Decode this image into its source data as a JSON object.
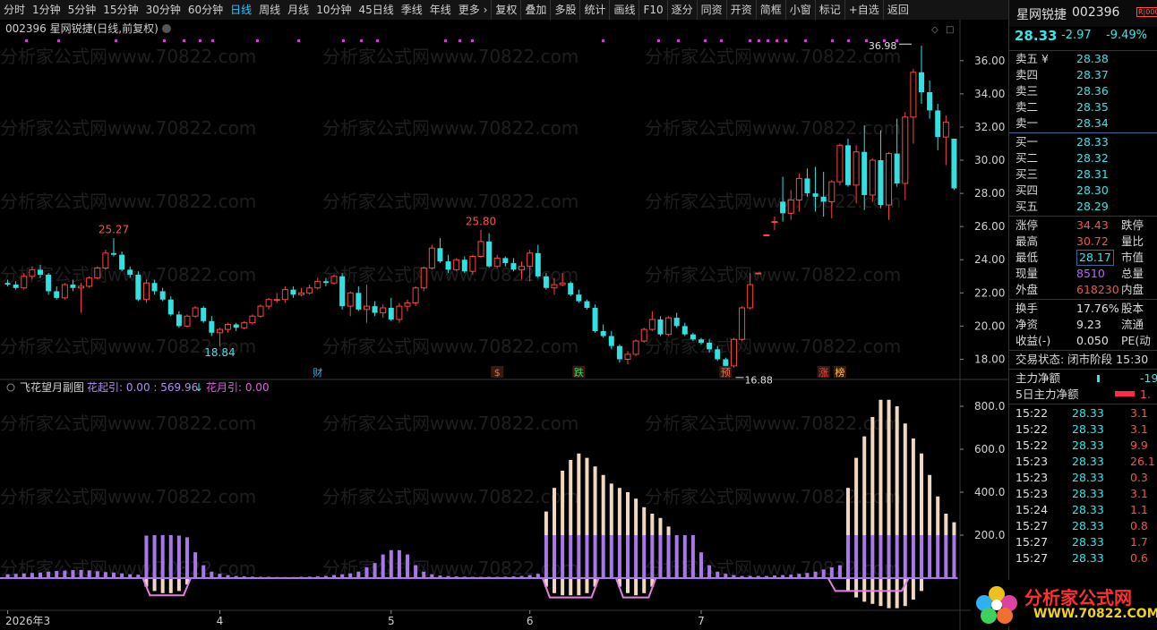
{
  "toolbar": {
    "periods": [
      "分时",
      "1分钟",
      "5分钟",
      "15分钟",
      "30分钟",
      "60分钟",
      "日线",
      "周线",
      "月线",
      "10分钟",
      "45日线",
      "季线",
      "年线",
      "更多 ›"
    ],
    "active_period": "日线",
    "tools": [
      "复权",
      "叠加",
      "多股",
      "统计",
      "画线",
      "F10",
      "逐分",
      "同资",
      "开资",
      "简框",
      "小窗",
      "标记",
      "+自选",
      "返回"
    ]
  },
  "stock": {
    "name": "星网锐捷",
    "code": "002396",
    "badge": "R|000",
    "price": "28.33",
    "change": "-2.97",
    "change_pct": "-9.49%"
  },
  "chart_header": "002396 星网锐捷(日线,前复权)",
  "indicator_header": {
    "name": "飞花望月副图",
    "term1_label": "花起引: 0.00 : 569.96",
    "arrow": "↓",
    "term2_label": "花月引: 0.00"
  },
  "watermark": "分析家公式网www.70822.com",
  "annotations": {
    "high_left": "25.27",
    "low_left": "18.84",
    "high_mid": "25.80",
    "low_right": "16.88",
    "high_right": "36.98"
  },
  "event_markers": [
    "财",
    "$",
    "跌",
    "预",
    "涨",
    "榜"
  ],
  "price_axis": {
    "min": 17,
    "max": 37.5,
    "ticks": [
      36.0,
      34.0,
      32.0,
      30.0,
      28.0,
      26.0,
      24.0,
      22.0,
      20.0,
      18.0
    ]
  },
  "ind_axis": {
    "min": -150,
    "max": 900,
    "ticks": [
      800.0,
      600.0,
      400.0,
      200.0
    ]
  },
  "x_axis_labels": [
    {
      "text": "2026年3",
      "index": 0
    },
    {
      "text": "4",
      "index": 26
    },
    {
      "text": "5",
      "index": 47
    },
    {
      "text": "6",
      "index": 64
    },
    {
      "text": "7",
      "index": 85
    }
  ],
  "order_book": {
    "sell": [
      {
        "label": "卖五 ¥",
        "price": "28.38"
      },
      {
        "label": "卖四",
        "price": "28.37"
      },
      {
        "label": "卖三",
        "price": "28.36"
      },
      {
        "label": "卖二",
        "price": "28.35"
      },
      {
        "label": "卖一",
        "price": "28.34"
      }
    ],
    "buy": [
      {
        "label": "买一",
        "price": "28.33"
      },
      {
        "label": "买二",
        "price": "28.32"
      },
      {
        "label": "买三",
        "price": "28.31"
      },
      {
        "label": "买四",
        "price": "28.30"
      },
      {
        "label": "买五",
        "price": "28.29"
      }
    ]
  },
  "stats": [
    {
      "label": "涨停",
      "value": "34.43",
      "color": "red",
      "label2": "跌停"
    },
    {
      "label": "最高",
      "value": "30.72",
      "color": "red",
      "label2": "量比"
    },
    {
      "label": "最低",
      "value": "28.17",
      "color": "cyan",
      "label2": "市值"
    },
    {
      "label": "现量",
      "value": "8510",
      "color": "purple",
      "label2": "总量"
    },
    {
      "label": "外盘",
      "value": "618230",
      "color": "red",
      "label2": "内盘"
    }
  ],
  "stats2": [
    {
      "label": "换手",
      "value": "17.76%",
      "label2": "股本"
    },
    {
      "label": "净资",
      "value": "9.23",
      "label2": "流通"
    },
    {
      "label": "收益(-)",
      "value": "0.050",
      "label2": "PE(动"
    }
  ],
  "trade_status": "交易状态: 闭市阶段 15:30",
  "flows": [
    {
      "label": "主力净额",
      "value": "-19.",
      "bar": "cyan"
    },
    {
      "label": "5日主力净额",
      "value": "1.",
      "bar": "red"
    }
  ],
  "ticks": [
    {
      "time": "15:22",
      "price": "28.33",
      "vol": "3.1"
    },
    {
      "time": "15:22",
      "price": "28.33",
      "vol": "3.1"
    },
    {
      "time": "15:22",
      "price": "28.33",
      "vol": "9.9"
    },
    {
      "time": "15:23",
      "price": "28.33",
      "vol": "26.1"
    },
    {
      "time": "15:23",
      "price": "28.33",
      "vol": "0.3"
    },
    {
      "time": "15:23",
      "price": "28.33",
      "vol": "3.1"
    },
    {
      "time": "15:24",
      "price": "28.33",
      "vol": "1.1"
    },
    {
      "time": "15:27",
      "price": "28.33",
      "vol": "0.8"
    },
    {
      "time": "15:27",
      "price": "28.33",
      "vol": "1.7"
    },
    {
      "time": "15:27",
      "price": "28.33",
      "vol": "0.6"
    }
  ],
  "logo": {
    "line1": "分析家公式网",
    "line2": "WWW.70822.COM"
  },
  "colors": {
    "up": "#ff4444",
    "down": "#33e0e0",
    "ind_purple": "#a779e8",
    "ind_tan": "#f0d8c0",
    "ind_pink": "#e080e0"
  },
  "chart_data": {
    "type": "candlestick",
    "title": "002396 星网锐捷(日线,前复权)",
    "candles": [
      [
        22.6,
        22.8,
        22.4,
        22.5
      ],
      [
        22.5,
        22.7,
        22.2,
        22.3
      ],
      [
        22.3,
        23.2,
        22.2,
        23.0
      ],
      [
        23.0,
        23.6,
        22.8,
        23.4
      ],
      [
        23.4,
        23.7,
        22.9,
        23.1
      ],
      [
        23.1,
        23.2,
        21.9,
        22.1
      ],
      [
        22.1,
        22.4,
        21.6,
        21.7
      ],
      [
        21.7,
        22.6,
        21.6,
        22.5
      ],
      [
        22.5,
        22.8,
        22.1,
        22.3
      ],
      [
        22.3,
        22.6,
        20.8,
        22.4
      ],
      [
        22.4,
        23.0,
        22.3,
        22.9
      ],
      [
        22.9,
        23.6,
        22.8,
        23.5
      ],
      [
        23.5,
        24.6,
        23.4,
        24.4
      ],
      [
        24.4,
        25.3,
        24.2,
        24.3
      ],
      [
        24.3,
        24.5,
        23.3,
        23.4
      ],
      [
        23.4,
        23.6,
        22.9,
        23.1
      ],
      [
        23.1,
        23.3,
        21.5,
        21.6
      ],
      [
        21.6,
        22.8,
        21.4,
        22.6
      ],
      [
        22.6,
        22.8,
        21.9,
        22.1
      ],
      [
        22.1,
        22.3,
        21.5,
        21.6
      ],
      [
        21.6,
        21.8,
        20.6,
        20.7
      ],
      [
        20.7,
        20.9,
        19.9,
        20.0
      ],
      [
        20.0,
        20.7,
        19.9,
        20.6
      ],
      [
        20.6,
        21.2,
        20.5,
        21.1
      ],
      [
        21.1,
        21.2,
        20.2,
        20.3
      ],
      [
        20.3,
        20.6,
        19.4,
        19.6
      ],
      [
        19.6,
        19.9,
        18.8,
        19.8
      ],
      [
        19.8,
        20.2,
        19.6,
        20.1
      ],
      [
        20.1,
        20.2,
        19.7,
        19.9
      ],
      [
        19.9,
        20.3,
        19.8,
        20.2
      ],
      [
        20.2,
        20.7,
        20.1,
        20.6
      ],
      [
        20.6,
        21.3,
        20.5,
        21.2
      ],
      [
        21.2,
        21.7,
        21.0,
        21.6
      ],
      [
        21.6,
        22.0,
        21.4,
        21.6
      ],
      [
        21.6,
        22.4,
        21.4,
        22.2
      ],
      [
        22.2,
        22.4,
        21.7,
        21.9
      ],
      [
        21.9,
        22.3,
        21.8,
        22.0
      ],
      [
        22.0,
        22.5,
        21.9,
        22.3
      ],
      [
        22.3,
        22.9,
        22.2,
        22.7
      ],
      [
        22.7,
        22.9,
        22.4,
        22.6
      ],
      [
        22.6,
        23.1,
        22.5,
        23.0
      ],
      [
        23.0,
        23.2,
        21.0,
        21.2
      ],
      [
        21.2,
        22.1,
        20.6,
        22.0
      ],
      [
        22.0,
        22.4,
        20.9,
        21.0
      ],
      [
        21.0,
        22.5,
        20.2,
        21.2
      ],
      [
        21.2,
        21.5,
        20.6,
        20.8
      ],
      [
        20.8,
        21.3,
        20.5,
        21.1
      ],
      [
        21.1,
        21.7,
        20.3,
        20.4
      ],
      [
        20.4,
        21.4,
        20.2,
        21.2
      ],
      [
        21.2,
        21.6,
        20.9,
        21.4
      ],
      [
        21.4,
        22.4,
        21.2,
        22.3
      ],
      [
        22.3,
        23.6,
        22.1,
        23.5
      ],
      [
        23.5,
        24.9,
        23.4,
        24.7
      ],
      [
        24.7,
        25.3,
        23.8,
        23.9
      ],
      [
        23.9,
        24.3,
        23.2,
        23.4
      ],
      [
        23.4,
        24.1,
        23.3,
        24.0
      ],
      [
        24.0,
        24.2,
        23.2,
        23.3
      ],
      [
        23.3,
        24.3,
        23.1,
        24.2
      ],
      [
        24.2,
        25.8,
        24.1,
        25.1
      ],
      [
        25.1,
        25.6,
        23.5,
        23.6
      ],
      [
        23.6,
        24.3,
        23.5,
        24.1
      ],
      [
        24.1,
        24.2,
        23.6,
        23.8
      ],
      [
        23.8,
        24.1,
        23.3,
        23.4
      ],
      [
        23.4,
        23.9,
        22.8,
        23.6
      ],
      [
        23.6,
        24.6,
        22.7,
        24.4
      ],
      [
        24.4,
        24.9,
        22.9,
        23.0
      ],
      [
        23.0,
        23.2,
        22.2,
        22.3
      ],
      [
        22.3,
        22.9,
        21.9,
        22.5
      ],
      [
        22.5,
        23.2,
        22.4,
        22.6
      ],
      [
        22.6,
        22.7,
        21.8,
        21.9
      ],
      [
        21.9,
        22.2,
        21.4,
        21.5
      ],
      [
        21.5,
        21.6,
        21.0,
        21.1
      ],
      [
        21.1,
        21.3,
        19.6,
        19.7
      ],
      [
        19.7,
        20.1,
        19.3,
        19.4
      ],
      [
        19.4,
        19.7,
        18.6,
        18.8
      ],
      [
        18.8,
        18.9,
        17.8,
        18.0
      ],
      [
        18.0,
        18.5,
        17.7,
        18.3
      ],
      [
        18.3,
        19.2,
        18.2,
        19.1
      ],
      [
        19.1,
        19.9,
        19.0,
        19.8
      ],
      [
        19.8,
        20.9,
        19.7,
        20.4
      ],
      [
        20.4,
        20.6,
        19.4,
        19.5
      ],
      [
        19.5,
        20.6,
        19.4,
        20.5
      ],
      [
        20.5,
        20.8,
        19.9,
        20.0
      ],
      [
        20.0,
        20.2,
        19.4,
        19.5
      ],
      [
        19.5,
        19.6,
        19.1,
        19.2
      ],
      [
        19.2,
        19.3,
        18.9,
        19.0
      ],
      [
        19.0,
        19.2,
        18.4,
        18.6
      ],
      [
        18.6,
        18.8,
        17.9,
        18.0
      ],
      [
        18.0,
        18.1,
        16.9,
        17.6
      ],
      [
        17.6,
        19.3,
        17.5,
        19.2
      ],
      [
        19.2,
        21.2,
        19.1,
        21.1
      ],
      [
        21.1,
        23.2,
        21.0,
        22.5
      ],
      [
        23.2,
        23.2,
        23.2,
        23.2
      ],
      [
        25.5,
        25.5,
        25.5,
        25.5
      ],
      [
        26.3,
        26.6,
        25.8,
        26.3
      ],
      [
        27.5,
        29.0,
        26.3,
        26.8
      ],
      [
        26.8,
        28.2,
        26.4,
        27.6
      ],
      [
        27.6,
        29.2,
        26.9,
        28.9
      ],
      [
        28.9,
        29.5,
        27.8,
        28.0
      ],
      [
        28.0,
        29.6,
        26.9,
        27.8
      ],
      [
        27.8,
        29.3,
        26.6,
        27.5
      ],
      [
        27.5,
        28.8,
        26.5,
        28.7
      ],
      [
        28.7,
        31.0,
        28.5,
        30.9
      ],
      [
        30.9,
        31.3,
        28.4,
        28.5
      ],
      [
        28.5,
        30.9,
        27.4,
        30.5
      ],
      [
        30.5,
        32.1,
        27.0,
        27.9
      ],
      [
        27.9,
        30.1,
        27.5,
        30.0
      ],
      [
        30.0,
        31.8,
        27.1,
        27.3
      ],
      [
        27.3,
        30.5,
        26.4,
        30.4
      ],
      [
        30.4,
        32.5,
        28.4,
        28.6
      ],
      [
        28.6,
        32.9,
        27.6,
        32.6
      ],
      [
        32.6,
        35.5,
        31.0,
        35.3
      ],
      [
        35.3,
        36.9,
        33.4,
        34.1
      ],
      [
        34.1,
        34.8,
        32.5,
        33.0
      ],
      [
        33.0,
        33.4,
        30.6,
        31.4
      ],
      [
        31.4,
        32.7,
        29.7,
        32.3
      ],
      [
        31.3,
        31.3,
        28.2,
        28.3
      ]
    ],
    "indicator": {
      "purple_bars": [
        18,
        20,
        22,
        24,
        26,
        30,
        33,
        35,
        37,
        38,
        36,
        32,
        28,
        26,
        22,
        18,
        16,
        198,
        200,
        200,
        200,
        198,
        190,
        120,
        60,
        30,
        20,
        14,
        10,
        8,
        7,
        6,
        6,
        5,
        5,
        5,
        6,
        7,
        8,
        10,
        14,
        18,
        22,
        30,
        50,
        70,
        110,
        130,
        130,
        110,
        60,
        30,
        18,
        12,
        10,
        8,
        7,
        6,
        6,
        6,
        6,
        7,
        8,
        10,
        14,
        20,
        200,
        200,
        200,
        200,
        200,
        200,
        200,
        200,
        200,
        200,
        200,
        200,
        200,
        200,
        200,
        200,
        200,
        200,
        200,
        120,
        60,
        30,
        20,
        14,
        10,
        10,
        10,
        10,
        12,
        14,
        16,
        20,
        24,
        30,
        40,
        50,
        60,
        200,
        200,
        200,
        200,
        200,
        200,
        200,
        200,
        200,
        200,
        200,
        200,
        200,
        200,
        200,
        200,
        200,
        200,
        200,
        200,
        200
      ],
      "tan_up": [
        0,
        0,
        0,
        0,
        0,
        0,
        0,
        0,
        0,
        0,
        0,
        0,
        0,
        0,
        0,
        0,
        0,
        0,
        0,
        0,
        0,
        0,
        0,
        0,
        0,
        0,
        0,
        0,
        0,
        0,
        0,
        0,
        0,
        0,
        0,
        0,
        0,
        0,
        0,
        0,
        0,
        0,
        0,
        0,
        0,
        0,
        0,
        0,
        0,
        0,
        0,
        0,
        0,
        0,
        0,
        0,
        0,
        0,
        0,
        0,
        0,
        0,
        0,
        0,
        0,
        0,
        310,
        420,
        500,
        550,
        580,
        560,
        520,
        480,
        440,
        420,
        400,
        370,
        330,
        300,
        280,
        240,
        0,
        0,
        0,
        0,
        0,
        0,
        0,
        0,
        0,
        0,
        0,
        0,
        0,
        0,
        0,
        0,
        0,
        0,
        0,
        0,
        0,
        420,
        560,
        660,
        750,
        830,
        830,
        800,
        720,
        650,
        580,
        480,
        380,
        300,
        260,
        280,
        460,
        600,
        660,
        670,
        670,
        560
      ],
      "tan_down": [
        0,
        0,
        0,
        0,
        0,
        0,
        0,
        0,
        0,
        0,
        0,
        0,
        0,
        0,
        0,
        0,
        0,
        -40,
        -60,
        -70,
        -70,
        -60,
        -30,
        0,
        0,
        0,
        0,
        0,
        0,
        0,
        0,
        0,
        0,
        0,
        0,
        0,
        0,
        0,
        0,
        0,
        0,
        0,
        0,
        0,
        0,
        0,
        0,
        0,
        0,
        0,
        0,
        0,
        0,
        0,
        0,
        0,
        0,
        0,
        0,
        0,
        0,
        0,
        0,
        0,
        0,
        0,
        -40,
        -70,
        -80,
        -80,
        -80,
        -70,
        -40,
        0,
        0,
        -40,
        -70,
        -80,
        -70,
        -40,
        0,
        0,
        0,
        0,
        0,
        0,
        0,
        0,
        0,
        0,
        0,
        0,
        0,
        0,
        0,
        0,
        0,
        0,
        0,
        0,
        0,
        0,
        0,
        -60,
        -90,
        -110,
        -120,
        -130,
        -140,
        -140,
        -130,
        -100,
        -60,
        0,
        0,
        0,
        0,
        0,
        0,
        0,
        0,
        0,
        0,
        0
      ]
    }
  }
}
